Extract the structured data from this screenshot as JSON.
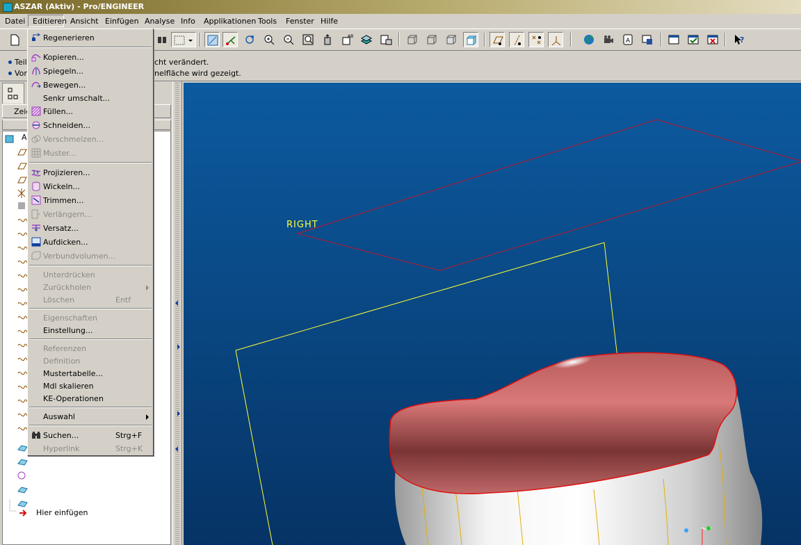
{
  "window": {
    "title": "ASZAR (Aktiv) - Pro/ENGINEER"
  },
  "menubar": {
    "items": [
      "Datei",
      "Editieren",
      "Ansicht",
      "Einfügen",
      "Analyse",
      "Info",
      "Applikationen",
      "Tools",
      "Fenster",
      "Hilfe"
    ]
  },
  "messages": {
    "line1_prefix": "Teil",
    "line1_suffix": "cht verändert.",
    "line2_prefix": "Vor",
    "line2_suffix": "nelfläche wird gezeigt."
  },
  "leftpanel": {
    "tab_label": "Zeig",
    "tree_root": "A",
    "insert_here": "Hier einfügen"
  },
  "viewport": {
    "datum_label": "RIGHT"
  },
  "dropdown": {
    "items": [
      {
        "label": "Regenerieren",
        "shortcut": "",
        "disabled": false,
        "icon": "regenerate-icon"
      },
      {
        "label": "Kopieren...",
        "shortcut": "",
        "disabled": false,
        "icon": "copy-icon"
      },
      {
        "label": "Spiegeln...",
        "shortcut": "",
        "disabled": false,
        "icon": "mirror-icon"
      },
      {
        "label": "Bewegen...",
        "shortcut": "",
        "disabled": false,
        "icon": "move-icon"
      },
      {
        "label": "Senkr umschalt...",
        "shortcut": "",
        "disabled": false,
        "icon": ""
      },
      {
        "label": "Füllen...",
        "shortcut": "",
        "disabled": false,
        "icon": "fill-icon"
      },
      {
        "label": "Schneiden...",
        "shortcut": "",
        "disabled": false,
        "icon": "intersect-icon"
      },
      {
        "label": "Verschmelzen...",
        "shortcut": "",
        "disabled": true,
        "icon": "merge-icon"
      },
      {
        "label": "Muster...",
        "shortcut": "",
        "disabled": true,
        "icon": "pattern-icon"
      },
      {
        "label": "Projizieren...",
        "shortcut": "",
        "disabled": false,
        "icon": "project-icon"
      },
      {
        "label": "Wickeln...",
        "shortcut": "",
        "disabled": false,
        "icon": "wrap-icon"
      },
      {
        "label": "Trimmen...",
        "shortcut": "",
        "disabled": false,
        "icon": "trim-icon"
      },
      {
        "label": "Verlängern...",
        "shortcut": "",
        "disabled": true,
        "icon": "extend-icon"
      },
      {
        "label": "Versatz...",
        "shortcut": "",
        "disabled": false,
        "icon": "offset-icon"
      },
      {
        "label": "Aufdicken...",
        "shortcut": "",
        "disabled": false,
        "icon": "thicken-icon"
      },
      {
        "label": "Verbundvolumen...",
        "shortcut": "",
        "disabled": true,
        "icon": "solidify-icon"
      },
      {
        "label": "Unterdrücken",
        "shortcut": "",
        "disabled": true,
        "icon": ""
      },
      {
        "label": "Zurückholen",
        "shortcut": "",
        "disabled": true,
        "icon": ""
      },
      {
        "label": "Löschen",
        "shortcut": "Entf",
        "disabled": true,
        "icon": ""
      },
      {
        "label": "Eigenschaften",
        "shortcut": "",
        "disabled": true,
        "icon": ""
      },
      {
        "label": "Einstellung...",
        "shortcut": "",
        "disabled": false,
        "icon": ""
      },
      {
        "label": "Referenzen",
        "shortcut": "",
        "disabled": true,
        "icon": ""
      },
      {
        "label": "Definition",
        "shortcut": "",
        "disabled": true,
        "icon": ""
      },
      {
        "label": "Mustertabelle...",
        "shortcut": "",
        "disabled": false,
        "icon": ""
      },
      {
        "label": "Mdl skalieren",
        "shortcut": "",
        "disabled": false,
        "icon": ""
      },
      {
        "label": "KE-Operationen",
        "shortcut": "",
        "disabled": false,
        "icon": ""
      },
      {
        "label": "Auswahl",
        "shortcut": "",
        "disabled": false,
        "icon": ""
      },
      {
        "label": "Suchen...",
        "shortcut": "Strg+F",
        "disabled": false,
        "icon": "binoculars-icon"
      },
      {
        "label": "Hyperlink",
        "shortcut": "Strg+K",
        "disabled": true,
        "icon": ""
      }
    ]
  },
  "colors": {
    "viewport_top": "#0c5aa0",
    "viewport_bottom": "#063365",
    "datum_yellow": "#ffff33",
    "datum_red": "#a0203c",
    "surface_red": "#d46a6a"
  }
}
